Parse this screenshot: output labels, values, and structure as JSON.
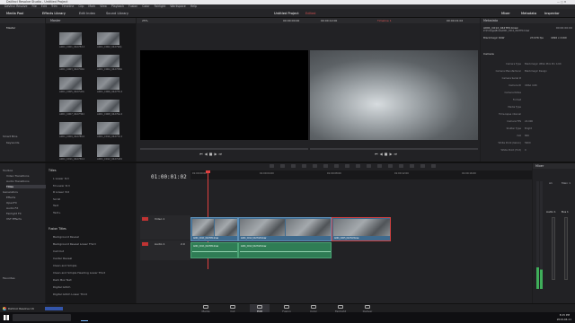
{
  "window": {
    "app_name": "DaVinci Resolve Studio - Untitled Project",
    "project_title": "Untitled Project"
  },
  "menu": [
    "DaVinci Resolve",
    "File",
    "Edit",
    "Trim",
    "Timeline",
    "Clip",
    "Mark",
    "View",
    "Playback",
    "Fusion",
    "Color",
    "Fairlight",
    "Workspace",
    "Help"
  ],
  "toolbar": {
    "media_pool": "Media Pool",
    "effects_library": "Effects Library",
    "edit_index": "Edit Index",
    "sound_library": "Sound Library",
    "project": "Untitled Project",
    "edited": "Edited",
    "mixer": "Mixer",
    "metadata": "Metadata",
    "inspector": "Inspector"
  },
  "media": {
    "bin": "Master",
    "smart_bins": "Smart Bins",
    "keywords": "Keywords",
    "clips": [
      "A001_C001_0427EX.braw",
      "A001_C002_0427WQ.braw",
      "A001_C003_0427DN.braw",
      "A001_C004_0427MR.braw",
      "A001_C005_0427LP.braw",
      "A001_C006_0427TS.braw",
      "A001_C007_0427HZ.braw",
      "A001_C008_0427KA.braw",
      "A001_C009_0427BV.braw",
      "A001_C010_0427YU.braw",
      "A001_C011_0427PO.braw",
      "A001_C012_0427GE.braw"
    ]
  },
  "viewer": {
    "zoom": "25%",
    "source_tc": "00:00:00:00",
    "duration": "00:00:12:00",
    "timeline_name": "Timeline 1",
    "timeline_tc": "00:00:01:02"
  },
  "metadata": {
    "clip_name": "A001_C012_0427EX.braw",
    "clip_path": "Z:\\Footage\\Braw\\A001_C012_0427EX.braw",
    "codec": "Blackmagic RAW",
    "fps": "23.976 fps",
    "resolution": "4096 x 2160",
    "tc": "00:00:00:00",
    "section": "Camera",
    "rows": [
      {
        "k": "Camera Type",
        "v": "Blackmagic URSA Mini Pro 4.6K"
      },
      {
        "k": "Camera Manufacturer",
        "v": "Blackmagic Design"
      },
      {
        "k": "Camera Serial #",
        "v": ""
      },
      {
        "k": "Camera ID",
        "v": "URSA 4.6K"
      },
      {
        "k": "Camera Notes",
        "v": ""
      },
      {
        "k": "Format",
        "v": ""
      },
      {
        "k": "Media Type",
        "v": ""
      },
      {
        "k": "Time-lapse interval",
        "v": ""
      },
      {
        "k": "Camera FPS",
        "v": "24.000"
      },
      {
        "k": "Shutter Type",
        "v": "Bright"
      },
      {
        "k": "ISO",
        "v": "800"
      },
      {
        "k": "White Point (Kelvin)",
        "v": "5600"
      },
      {
        "k": "White Point (Tint)",
        "v": "0"
      }
    ]
  },
  "effects": {
    "groups": [
      "Toolbox",
      "Video Transitions",
      "Audio Transitions",
      "Titles",
      "Generators",
      "Effects",
      "OpenFX",
      "Audio FX",
      "Fairlight FX",
      "VST Effects"
    ],
    "titles_header": "Titles",
    "titles": [
      "L Lower 3rd",
      "M Lower 3rd",
      "R Lower 3rd",
      "Scroll",
      "Text",
      "Text+"
    ],
    "fusion_header": "Fusion Titles",
    "fusion": [
      "Background Reveal",
      "Background Reveal Lower Third",
      "Call Out",
      "Center Reveal",
      "Clean and Simple",
      "Clean and Simple Heading Lower Third",
      "Dark Box Text",
      "Digital Glitch",
      "Digital Glitch Lower Third"
    ],
    "favorites": "Favorites"
  },
  "timeline": {
    "timecode": "01:00:01:02",
    "ruler": [
      "01:00:00:00",
      "01:00:04:00",
      "01:00:08:00",
      "01:00:12:00",
      "01:00:16:00"
    ],
    "video_track": "Video 1",
    "audio_track": "Audio 1",
    "audio_chan": "2.0",
    "video_clips": [
      "A001_C011_0427PO.braw",
      "A001_C012_0427GE.braw",
      "A001_C005_0427LP.braw"
    ],
    "audio_clips": [
      "A001_C011_0427PO.braw",
      "A001_C012_0427GE.braw"
    ]
  },
  "mixer": {
    "title": "Mixer",
    "a1": "A1",
    "main": "Main 1",
    "audio1": "Audio 1",
    "bus1": "Bus 1"
  },
  "pages": [
    "Media",
    "Cut",
    "Edit",
    "Fusion",
    "Color",
    "Fairlight",
    "Deliver"
  ],
  "footer": {
    "brand": "DaVinci Resolve 16"
  },
  "taskbar": {
    "time": "8:15 PM",
    "date": "2019-04-11"
  }
}
